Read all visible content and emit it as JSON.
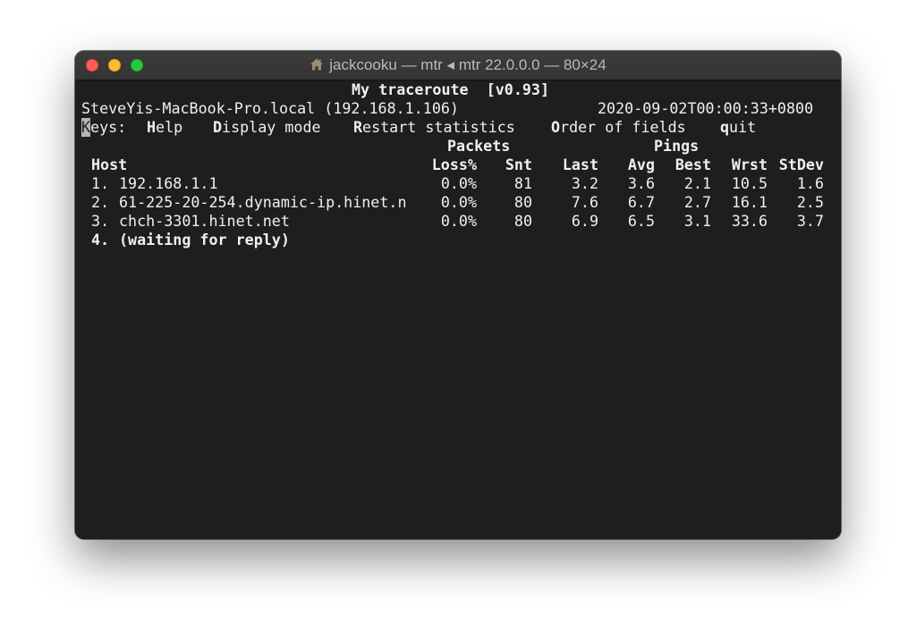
{
  "window": {
    "title": "jackcooku — mtr ◂ mtr 22.0.0.0 — 80×24"
  },
  "mtr": {
    "header": "My traceroute  [v0.93]",
    "host_info": "SteveYis-MacBook-Pro.local (192.168.1.106)",
    "timestamp": "2020-09-02T00:00:33+0800",
    "keys_label": "eys:",
    "keys_cursor_char": "K",
    "keys": [
      {
        "hotkey": "H",
        "rest": "elp"
      },
      {
        "hotkey": "D",
        "rest": "isplay mode"
      },
      {
        "hotkey": "R",
        "rest": "estart statistics"
      },
      {
        "hotkey": "O",
        "rest": "rder of fields"
      },
      {
        "hotkey": "q",
        "rest": "uit"
      }
    ],
    "group_headers": {
      "packets": "Packets",
      "pings": "Pings"
    },
    "columns": {
      "host": "Host",
      "loss": "Loss%",
      "snt": "Snt",
      "last": "Last",
      "avg": "Avg",
      "best": "Best",
      "wrst": "Wrst",
      "stdev": "StDev"
    },
    "rows": [
      {
        "hop": "1.",
        "host": "192.168.1.1",
        "loss": "0.0%",
        "snt": "81",
        "last": "3.2",
        "avg": "3.6",
        "best": "2.1",
        "wrst": "10.5",
        "stdev": "1.6"
      },
      {
        "hop": "2.",
        "host": "61-225-20-254.dynamic-ip.hinet.n",
        "loss": "0.0%",
        "snt": "80",
        "last": "7.6",
        "avg": "6.7",
        "best": "2.7",
        "wrst": "16.1",
        "stdev": "2.5"
      },
      {
        "hop": "3.",
        "host": "chch-3301.hinet.net",
        "loss": "0.0%",
        "snt": "80",
        "last": "6.9",
        "avg": "6.5",
        "best": "3.1",
        "wrst": "33.6",
        "stdev": "3.7"
      }
    ],
    "waiting_row": {
      "hop": "4.",
      "text": "(waiting for reply)"
    }
  }
}
